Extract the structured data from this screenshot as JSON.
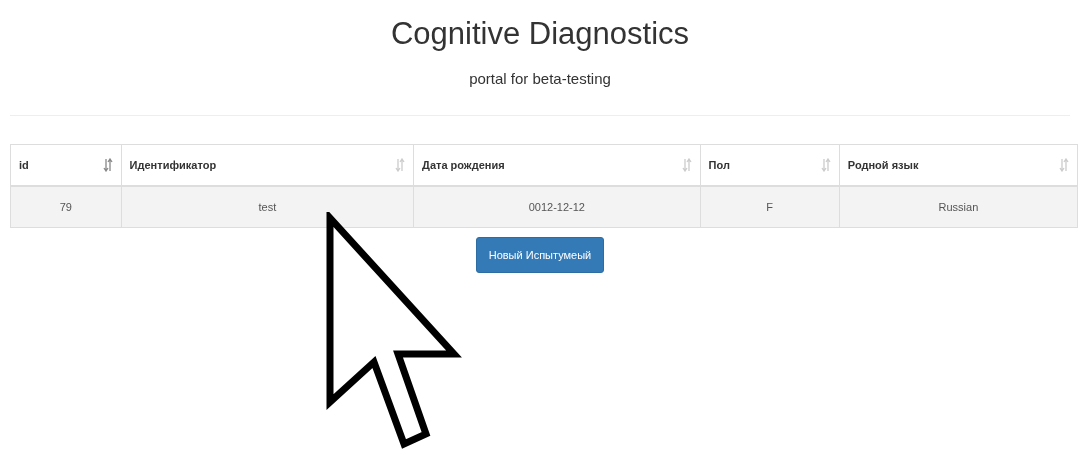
{
  "header": {
    "title": "Cognitive Diagnostics",
    "subtitle": "portal for beta-testing"
  },
  "table": {
    "columns": [
      {
        "label": "id",
        "sorted": true
      },
      {
        "label": "Идентификатор",
        "sorted": false
      },
      {
        "label": "Дата рождения",
        "sorted": false
      },
      {
        "label": "Пол",
        "sorted": false
      },
      {
        "label": "Родной язык",
        "sorted": false
      }
    ],
    "rows": [
      [
        "79",
        "test",
        "0012-12-12",
        "F",
        "Russian"
      ]
    ]
  },
  "new_subject_button": "Новый Испытумеый"
}
